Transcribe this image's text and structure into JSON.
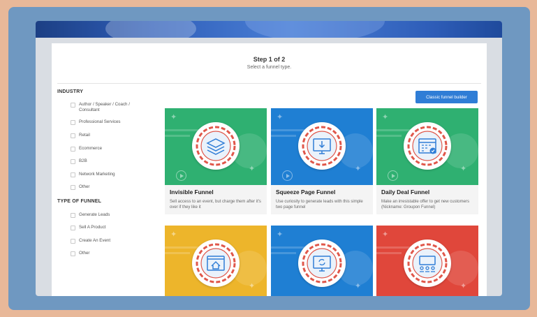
{
  "header": {
    "step_title": "Step 1 of 2",
    "step_subtitle": "Select a funnel type."
  },
  "sidebar": {
    "industry_heading": "INDUSTRY",
    "industry_options": [
      "Author / Speaker / Coach / Consultant",
      "Professional Services",
      "Retail",
      "Ecommerce",
      "B2B",
      "Network Marketing",
      "Other"
    ],
    "type_heading": "TYPE OF FUNNEL",
    "type_options": [
      "Generate Leads",
      "Sell A Product",
      "Create An Event",
      "Other"
    ]
  },
  "classic_button_label": "Classic funnel builder",
  "cards": [
    {
      "title": "Invisible Funnel",
      "desc": "Sell access to an event, but charge them after it's over if they like it",
      "color": "#2fb071",
      "icon": "layers-icon"
    },
    {
      "title": "Squeeze Page Funnel",
      "desc": "Use curiosity to generate leads with this simple two page funnel",
      "color": "#1f7fd3",
      "icon": "download-monitor-icon"
    },
    {
      "title": "Daily Deal Funnel",
      "desc": "Make an irresistable offer to get new customers (Nickname: Groupon Funnel)",
      "color": "#2fb071",
      "icon": "calendar-check-icon"
    },
    {
      "title": "",
      "desc": "",
      "color": "#edb52b",
      "icon": "home-page-icon"
    },
    {
      "title": "",
      "desc": "",
      "color": "#1f7fd3",
      "icon": "refresh-monitor-icon"
    },
    {
      "title": "",
      "desc": "",
      "color": "#e0473b",
      "icon": "presentation-icon"
    }
  ]
}
